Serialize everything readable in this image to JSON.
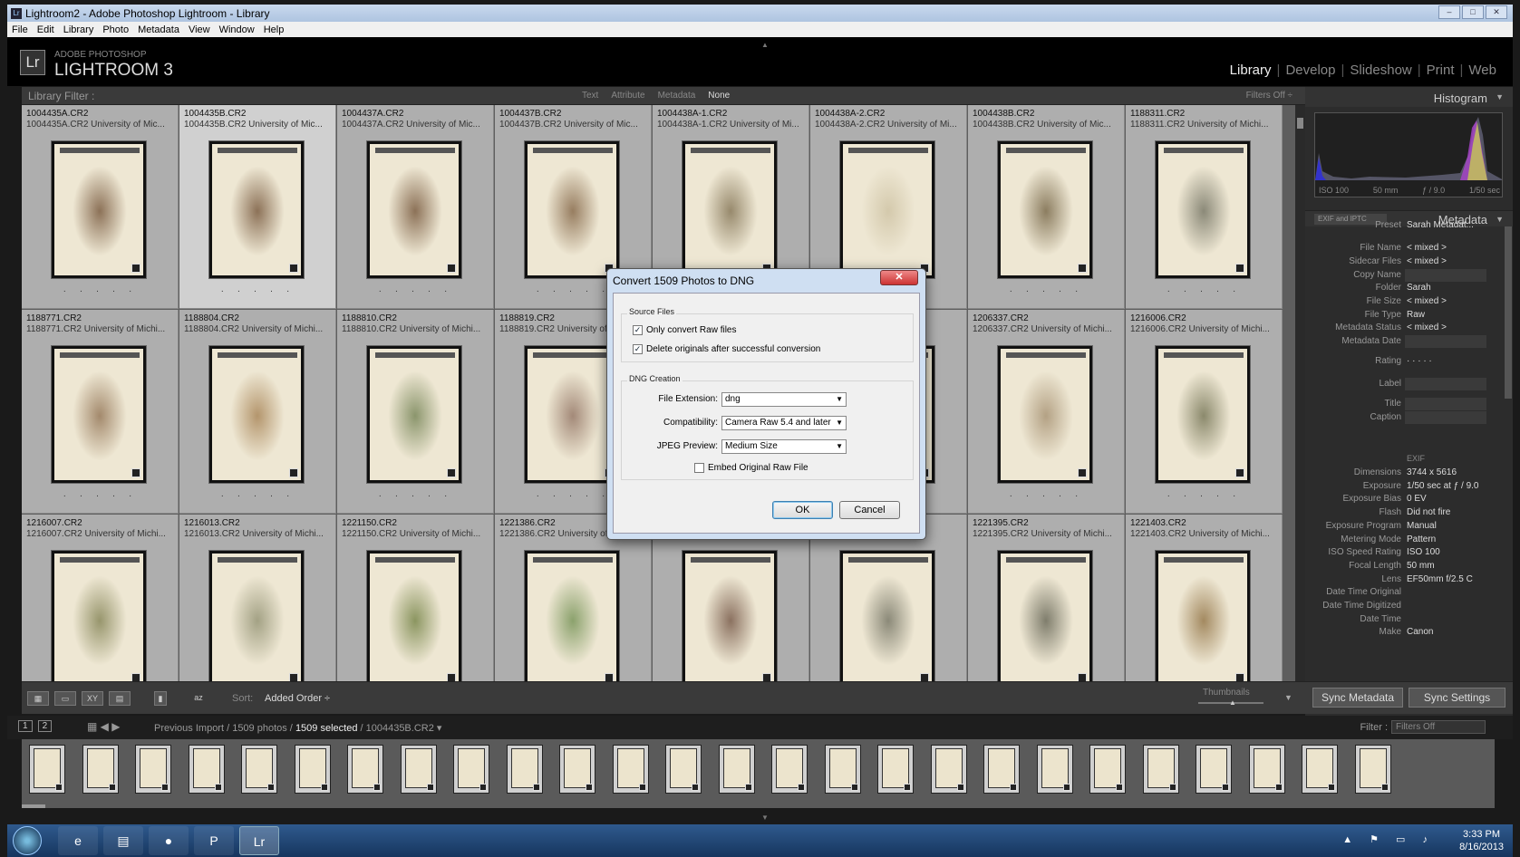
{
  "window": {
    "title": "Lightroom2 - Adobe Photoshop Lightroom - Library",
    "app_icon": "Lr",
    "buttons": [
      "–",
      "□",
      "✕"
    ]
  },
  "menu": [
    "File",
    "Edit",
    "Library",
    "Photo",
    "Metadata",
    "View",
    "Window",
    "Help"
  ],
  "header": {
    "logo": "Lr",
    "brand_line1": "ADOBE PHOTOSHOP",
    "brand_line2": "LIGHTROOM 3",
    "modules": [
      "Library",
      "Develop",
      "Slideshow",
      "Print",
      "Web"
    ],
    "active_module": "Library"
  },
  "filter_bar": {
    "label": "Library Filter :",
    "options": [
      "Text",
      "Attribute",
      "Metadata",
      "None"
    ],
    "active": "None",
    "filters_status": "Filters Off ÷"
  },
  "grid": {
    "cells": [
      {
        "name": "1004435A.CR2",
        "sub": "1004435A.CR2   University of Mic...",
        "plant": "#6b4a2e"
      },
      {
        "name": "1004435B.CR2",
        "sub": "1004435B.CR2   University of Mic...",
        "plant": "#6b4a2e",
        "selected": true
      },
      {
        "name": "1004437A.CR2",
        "sub": "1004437A.CR2   University of Mic...",
        "plant": "#6b4a2e"
      },
      {
        "name": "1004437B.CR2",
        "sub": "1004437B.CR2   University of Mic...",
        "plant": "#7a5a3a"
      },
      {
        "name": "1004438A-1.CR2",
        "sub": "1004438A-1.CR2   University of Mi...",
        "plant": "#7a6a4a"
      },
      {
        "name": "1004438A-2.CR2",
        "sub": "1004438A-2.CR2   University of Mi...",
        "plant": "#cbbf9f"
      },
      {
        "name": "1004438B.CR2",
        "sub": "1004438B.CR2   University of Mic...",
        "plant": "#6b5a3a"
      },
      {
        "name": "1188311.CR2",
        "sub": "1188311.CR2   University of Michi...",
        "plant": "#6a6a5a"
      },
      {
        "name": "1188771.CR2",
        "sub": "1188771.CR2   University of Michi...",
        "plant": "#8a6a4a"
      },
      {
        "name": "1188804.CR2",
        "sub": "1188804.CR2   University of Michi...",
        "plant": "#a07a4a"
      },
      {
        "name": "1188810.CR2",
        "sub": "1188810.CR2   University of Michi...",
        "plant": "#6a7a4a"
      },
      {
        "name": "1188819.CR2",
        "sub": "1188819.CR2   University of Michi...",
        "plant": "#8a6a5a"
      },
      {
        "name": "",
        "sub": "",
        "plant": "#8a7a5a"
      },
      {
        "name": "",
        "sub": "          University of Michi...",
        "plant": "#8a7a5a"
      },
      {
        "name": "1206337.CR2",
        "sub": "1206337.CR2   University of Michi...",
        "plant": "#a08a6a"
      },
      {
        "name": "1216006.CR2",
        "sub": "1216006.CR2   University of Michi...",
        "plant": "#6a6a4a"
      },
      {
        "name": "1216007.CR2",
        "sub": "1216007.CR2   University of Michi...",
        "plant": "#7a7a4a"
      },
      {
        "name": "1216013.CR2",
        "sub": "1216013.CR2   University of Michi...",
        "plant": "#8a8a6a"
      },
      {
        "name": "1221150.CR2",
        "sub": "1221150.CR2   University of Michi...",
        "plant": "#6a7a3a"
      },
      {
        "name": "1221386.CR2",
        "sub": "1221386.CR2   University of Michi...",
        "plant": "#6a8a4a"
      },
      {
        "name": "",
        "sub": "",
        "plant": "#6a4a3a"
      },
      {
        "name": "",
        "sub": "",
        "plant": "#6a6a5a"
      },
      {
        "name": "1221395.CR2",
        "sub": "1221395.CR2   University of Michi...",
        "plant": "#5a5a4a"
      },
      {
        "name": "1221403.CR2",
        "sub": "1221403.CR2   University of Michi...",
        "plant": "#8a6a3a"
      }
    ],
    "rating_dots": "· · · · ·"
  },
  "toolbar": {
    "sort_label": "Sort:",
    "sort_value": "Added Order ÷",
    "thumbnails_label": "Thumbnails"
  },
  "right_panel": {
    "histogram_title": "Histogram",
    "histogram_info": [
      "ISO 100",
      "50 mm",
      "ƒ / 9.0",
      "1/50 sec"
    ],
    "metadata_title": "Metadata",
    "metadata_set": "EXIF and IPTC",
    "rows": [
      {
        "k": "Preset",
        "v": "Sarah Metadat..."
      },
      {
        "k": "File Name",
        "v": "< mixed >"
      },
      {
        "k": "Sidecar Files",
        "v": "< mixed >"
      },
      {
        "k": "Copy Name",
        "v": ""
      },
      {
        "k": "Folder",
        "v": "Sarah"
      },
      {
        "k": "File Size",
        "v": "< mixed >"
      },
      {
        "k": "File Type",
        "v": "Raw"
      },
      {
        "k": "Metadata Status",
        "v": "< mixed >"
      },
      {
        "k": "Metadata Date",
        "v": ""
      },
      {
        "k": "Rating",
        "v": "· · · · ·"
      },
      {
        "k": "Label",
        "v": ""
      },
      {
        "k": "Title",
        "v": ""
      },
      {
        "k": "Caption",
        "v": ""
      }
    ],
    "exif_label": "EXIF",
    "exif_rows": [
      {
        "k": "Dimensions",
        "v": "3744 x 5616"
      },
      {
        "k": "Exposure",
        "v": "1/50 sec at ƒ / 9.0"
      },
      {
        "k": "Exposure Bias",
        "v": "0 EV"
      },
      {
        "k": "Flash",
        "v": "Did not fire"
      },
      {
        "k": "Exposure Program",
        "v": "Manual"
      },
      {
        "k": "Metering Mode",
        "v": "Pattern"
      },
      {
        "k": "ISO Speed Rating",
        "v": "ISO 100"
      },
      {
        "k": "Focal Length",
        "v": "50 mm"
      },
      {
        "k": "Lens",
        "v": "EF50mm f/2.5 C"
      },
      {
        "k": "Date Time Original",
        "v": ""
      },
      {
        "k": "Date Time Digitized",
        "v": ""
      },
      {
        "k": "Date Time",
        "v": ""
      },
      {
        "k": "Make",
        "v": "Canon"
      }
    ],
    "sync_metadata": "Sync Metadata",
    "sync_settings": "Sync Settings"
  },
  "filmstrip_bar": {
    "pages": [
      "1",
      "2"
    ],
    "crumb_prefix": "Previous Import / 1509 photos /",
    "crumb_selected": "1509 selected",
    "crumb_suffix": "/ 1004435B.CR2 ▾",
    "filter_label": "Filter :",
    "filter_value": "Filters Off"
  },
  "dialog": {
    "title": "Convert 1509 Photos to DNG",
    "source_group": "Source Files",
    "only_raw": "Only convert Raw files",
    "delete_originals": "Delete originals after successful conversion",
    "dng_group": "DNG Creation",
    "file_ext_label": "File Extension:",
    "file_ext_value": "dng",
    "compat_label": "Compatibility:",
    "compat_value": "Camera Raw 5.4 and later",
    "jpeg_label": "JPEG Preview:",
    "jpeg_value": "Medium Size",
    "embed_label": "Embed Original Raw File",
    "ok": "OK",
    "cancel": "Cancel"
  },
  "taskbar": {
    "time": "3:33 PM",
    "date": "8/16/2013",
    "lr_button": "Lr"
  }
}
